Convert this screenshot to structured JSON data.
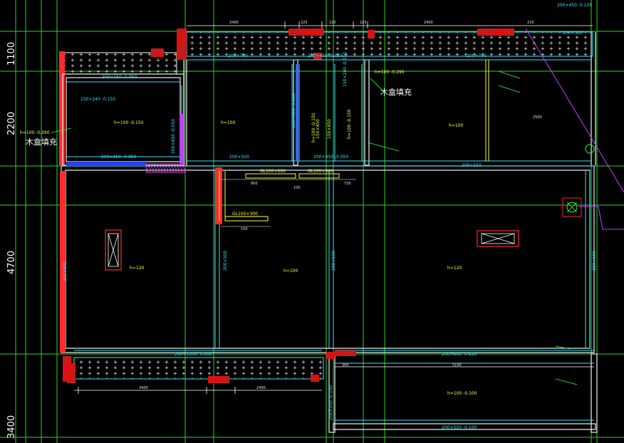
{
  "axis_dims": {
    "d1": "1100",
    "d2": "2200",
    "d3": "4700",
    "d4": "3400"
  },
  "top_dims": {
    "t1": "2400",
    "t2": "225",
    "t3": "225",
    "t4": "225",
    "t5": "2400",
    "t6": "225"
  },
  "top_right": {
    "tr1": "200×450 -0.100",
    "tr2": "200×350"
  },
  "beams": {
    "b1": "200×450 -0.050",
    "b2": "200×700",
    "b3": "200×450 -0.050",
    "b4": "200×700",
    "b5": "200×450 -0.050",
    "b6": "200×450 -0.050",
    "b7": "200×450 -0.050",
    "b8": "200×500",
    "b9": "200×550",
    "b10": "200×1200 -0.500",
    "b11": "200×600 -0.620",
    "b12": "200×550 -0.100",
    "v1": "200×450 -0.050",
    "v2": "200×500",
    "v3": "200×500",
    "v4": "200×500",
    "v5": "200×550 -0.100",
    "v6": "120×400 -0.050",
    "v7": "150×450",
    "v8": "150×450",
    "v9": "150×240 -0.150",
    "b13": "150×240 -0.150"
  },
  "levels": {
    "l1": "h=100 -0.150",
    "l2": "h=100",
    "l3": "h=100",
    "l4": "h=100 -0.290",
    "l5": "h=120",
    "l6": "h=100",
    "l7": "h=120",
    "l8": "h=100 -0.100",
    "l9": "h=100 -0.150",
    "l10": "h=100 -0.290",
    "l11": "h=100 -0.150"
  },
  "fill_notes": {
    "n1": "木盒填充",
    "n2": "木盒填充"
  },
  "lintels": {
    "g1": "GL100×000",
    "g2": "GL100×000",
    "g3": "GL100×300"
  },
  "small_dims": {
    "s1": "950",
    "s2": "720",
    "s3": "100",
    "s4": "150",
    "s5": "3400",
    "s6": "2400",
    "s7": "300",
    "s8": "5100",
    "s9": "2500"
  },
  "colors": {
    "background": "#000000",
    "beam_cyan": "#35e6ff",
    "grid_green": "#2bd42b",
    "wall_red": "#ff2a2a",
    "hatch_magenta": "#d040d0",
    "text_yellow": "#ffff3a",
    "wall_white": "#f2f2f2"
  }
}
